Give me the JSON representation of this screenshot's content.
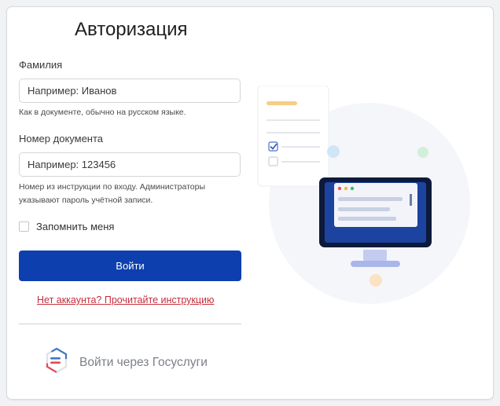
{
  "auth": {
    "title": "Авторизация",
    "surname": {
      "label": "Фамилия",
      "placeholder": "Например: Иванов",
      "hint": "Как в документе, обычно на русском языке."
    },
    "document": {
      "label": "Номер документа",
      "placeholder": "Например: 123456",
      "hint_line1": "Номер из инструкции по входу. Администраторы",
      "hint_line2": "указывают пароль учётной записи."
    },
    "remember_label": "Запомнить меня",
    "remember_checked": false,
    "login_button": "Войти",
    "register_link": "Нет аккаунта? Прочитайте инструкцию",
    "gosuslugi_button": "Войти через Госуслуги"
  },
  "colors": {
    "primary": "#0d3fae",
    "link": "#c62e3c",
    "muted": "#7c8087"
  },
  "icons": {
    "gosuslugi": "gosuslugi-logo-icon",
    "illustration": "computer-and-checklist-illustration"
  }
}
